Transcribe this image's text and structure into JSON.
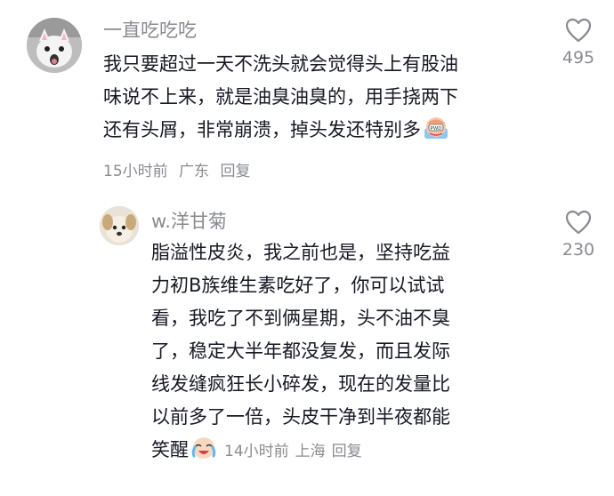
{
  "comments": [
    {
      "username": "一直吃吃吃",
      "body_lines": [
        "我只要超过一天不洗头就会觉得头上有股油",
        "味说不上来，就是油臭油臭的，用手挠两下",
        "还有头屑，非常崩溃，掉头发还特别多"
      ],
      "emoji": "crying-emoji",
      "time": "15小时前",
      "location": "广东",
      "reply_label": "回复",
      "likes": "495",
      "like_icon": "heart-outline-icon"
    },
    {
      "username": "w.洋甘菊",
      "body_lines": [
        "脂溢性皮炎，我之前也是，坚持吃益",
        "力初B族维生素吃好了，你可以试试",
        "看，我吃了不到俩星期，头不油不臭",
        "了，稳定大半年都没复发，而且发际",
        "线发缝疯狂长小碎发，现在的发量比",
        "以前多了一倍，头皮干净到半夜都能",
        "笑醒"
      ],
      "emoji": "laugh-cry-emoji",
      "time": "14小时前",
      "location": "上海",
      "reply_label": "回复",
      "likes": "230",
      "like_icon": "heart-outline-icon"
    }
  ]
}
